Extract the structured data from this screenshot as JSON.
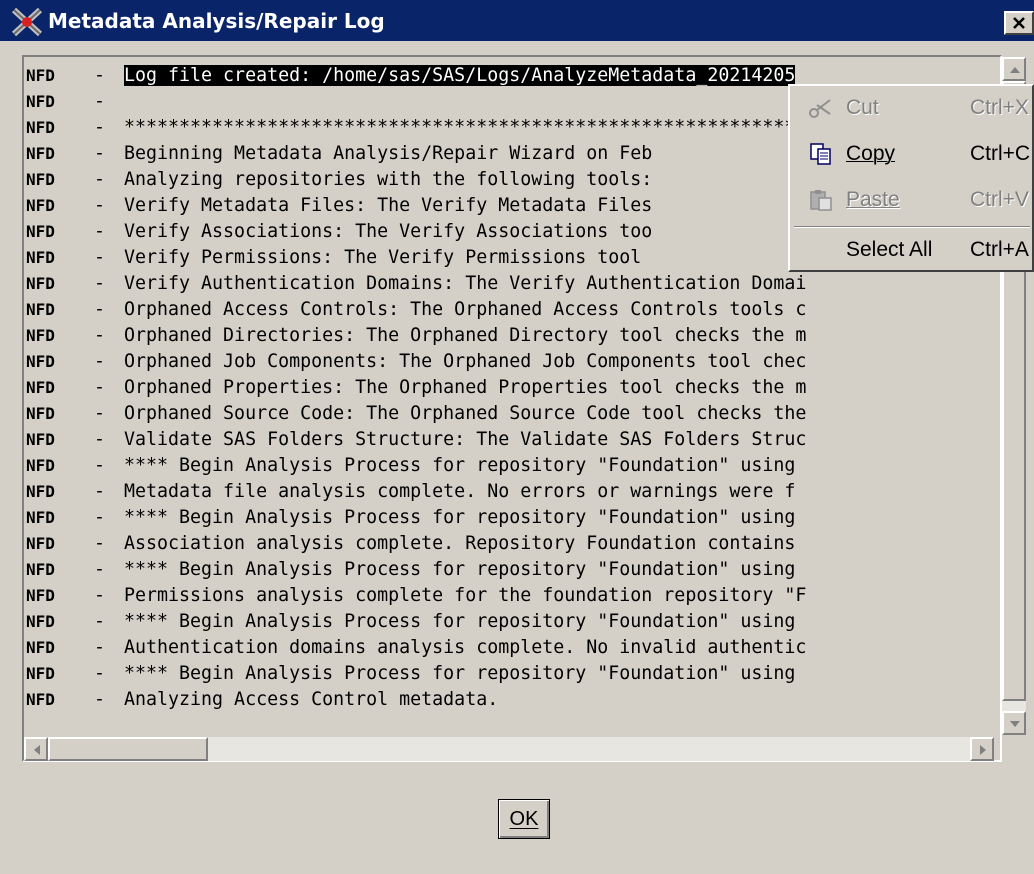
{
  "window": {
    "title": "Metadata Analysis/Repair Log",
    "close_glyph": "×"
  },
  "log": {
    "lines": [
      {
        "level": "NFD",
        "sep": "-",
        "text": "Log file created: /home/sas/SAS/Logs/AnalyzeMetadata_20214205"
      },
      {
        "level": "NFD",
        "sep": "-",
        "text": ""
      },
      {
        "level": "NFD",
        "sep": "-",
        "text": "**************************************************************"
      },
      {
        "level": "NFD",
        "sep": "-",
        "text": "Beginning Metadata Analysis/Repair Wizard on Feb"
      },
      {
        "level": "NFD",
        "sep": "-",
        "text": "Analyzing repositories with the following tools:"
      },
      {
        "level": "NFD",
        "sep": "-",
        "text": "Verify Metadata Files: The Verify Metadata Files"
      },
      {
        "level": "NFD",
        "sep": "-",
        "text": "Verify Associations: The Verify Associations too"
      },
      {
        "level": "NFD",
        "sep": "-",
        "text": "Verify Permissions: The Verify Permissions tool"
      },
      {
        "level": "NFD",
        "sep": "-",
        "text": "Verify Authentication Domains: The Verify Authentication Domai"
      },
      {
        "level": "NFD",
        "sep": "-",
        "text": "Orphaned Access Controls: The Orphaned Access Controls tools c"
      },
      {
        "level": "NFD",
        "sep": "-",
        "text": "Orphaned Directories: The Orphaned Directory tool checks the m"
      },
      {
        "level": "NFD",
        "sep": "-",
        "text": "Orphaned Job Components: The Orphaned Job Components tool chec"
      },
      {
        "level": "NFD",
        "sep": "-",
        "text": "Orphaned Properties: The Orphaned Properties tool checks the m"
      },
      {
        "level": "NFD",
        "sep": "-",
        "text": "Orphaned Source Code: The Orphaned Source Code tool checks the"
      },
      {
        "level": "NFD",
        "sep": "-",
        "text": "Validate SAS Folders Structure: The Validate SAS Folders Struc"
      },
      {
        "level": "NFD",
        "sep": "-",
        "text": "**** Begin Analysis Process for repository \"Foundation\" using"
      },
      {
        "level": "NFD",
        "sep": "-",
        "text": "Metadata file analysis complete.  No errors or warnings were f"
      },
      {
        "level": "NFD",
        "sep": "-",
        "text": "**** Begin Analysis Process for repository \"Foundation\" using"
      },
      {
        "level": "NFD",
        "sep": "-",
        "text": "Association analysis complete.  Repository Foundation contains"
      },
      {
        "level": "NFD",
        "sep": "-",
        "text": "**** Begin Analysis Process for repository \"Foundation\" using"
      },
      {
        "level": "NFD",
        "sep": "-",
        "text": "Permissions analysis complete for the foundation repository \"F"
      },
      {
        "level": "NFD",
        "sep": "-",
        "text": "**** Begin Analysis Process for repository \"Foundation\" using"
      },
      {
        "level": "NFD",
        "sep": "-",
        "text": "Authentication domains analysis complete. No invalid authentic"
      },
      {
        "level": "NFD",
        "sep": "-",
        "text": "**** Begin Analysis Process for repository \"Foundation\" using"
      },
      {
        "level": "NFD",
        "sep": "-",
        "text": "Analyzing Access Control metadata."
      }
    ]
  },
  "buttons": {
    "ok_label": "OK"
  },
  "context_menu": {
    "items": [
      {
        "label": "Cut",
        "shortcut": "Ctrl+X",
        "icon": "scissors-icon",
        "enabled": false
      },
      {
        "label": "Copy",
        "shortcut": "Ctrl+C",
        "icon": "copy-icon",
        "enabled": true
      },
      {
        "label": "Paste",
        "shortcut": "Ctrl+V",
        "icon": "paste-icon",
        "enabled": false
      },
      {
        "label": "Select All",
        "shortcut": "Ctrl+A",
        "icon": "",
        "enabled": true
      }
    ]
  },
  "colors": {
    "title_bar": "#0a246a",
    "window_face": "#d4d0c8",
    "selection": "#000000"
  }
}
